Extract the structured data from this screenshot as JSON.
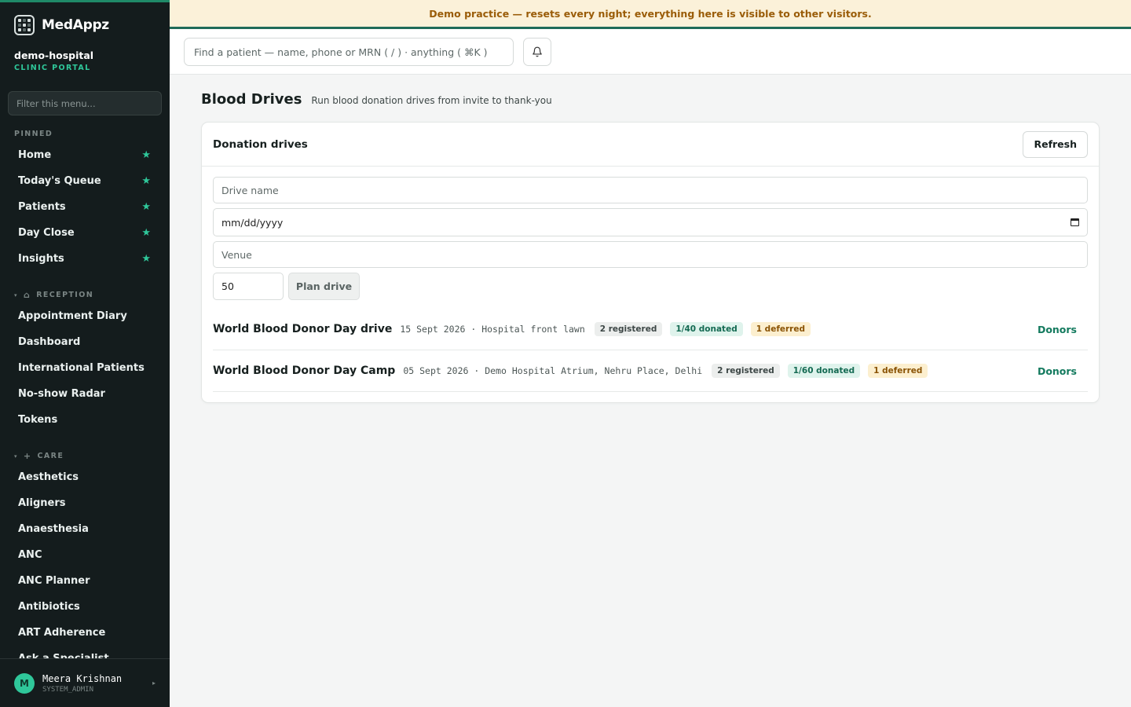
{
  "banner": {
    "text": "Demo practice — resets every night; everything here is visible to other visitors."
  },
  "brand": {
    "name": "MedAppz"
  },
  "org": {
    "name": "demo-hospital",
    "subtitle": "CLINIC PORTAL"
  },
  "sidebar": {
    "filter_placeholder": "Filter this menu...",
    "pinned_label": "PINNED",
    "pinned": [
      {
        "label": "Home",
        "icon": "star-icon"
      },
      {
        "label": "Today's Queue",
        "icon": "star-icon"
      },
      {
        "label": "Patients",
        "icon": "star-icon"
      },
      {
        "label": "Day Close",
        "icon": "star-icon"
      },
      {
        "label": "Insights",
        "icon": "star-icon"
      }
    ],
    "reception_label": "RECEPTION",
    "reception": [
      "Appointment Diary",
      "Dashboard",
      "International Patients",
      "No-show Radar",
      "Tokens"
    ],
    "care_label": "CARE",
    "care": [
      "Aesthetics",
      "Aligners",
      "Anaesthesia",
      "ANC",
      "ANC Planner",
      "Antibiotics",
      "ART Adherence",
      "Ask a Specialist"
    ]
  },
  "user": {
    "initial": "M",
    "name": "Meera Krishnan",
    "role": "SYSTEM_ADMIN"
  },
  "topbar": {
    "search_placeholder": "Find a patient — name, phone or MRN ( / ) · anything ( ⌘K )"
  },
  "page": {
    "title": "Blood Drives",
    "subtitle": "Run blood donation drives from invite to thank-you"
  },
  "card": {
    "title": "Donation drives",
    "refresh_label": "Refresh",
    "form": {
      "name_placeholder": "Drive name",
      "date_placeholder": "mm/dd/yyyy",
      "venue_placeholder": "Venue",
      "capacity_value": "50",
      "plan_label": "Plan drive"
    },
    "drives": [
      {
        "name": "World Blood Donor Day drive",
        "meta": "15 Sept 2026 · Hospital front lawn",
        "registered": "2 registered",
        "donated": "1/40 donated",
        "deferred": "1 deferred",
        "action": "Donors"
      },
      {
        "name": "World Blood Donor Day Camp",
        "meta": "05 Sept 2026 · Demo Hospital Atrium, Nehru Place, Delhi",
        "registered": "2 registered",
        "donated": "1/60 donated",
        "deferred": "1 deferred",
        "action": "Donors"
      }
    ]
  },
  "colors": {
    "accent": "#2fc79a",
    "sidebar_bg": "#141c1d",
    "banner_bg": "#fbf1d9",
    "link": "#137a5e"
  }
}
